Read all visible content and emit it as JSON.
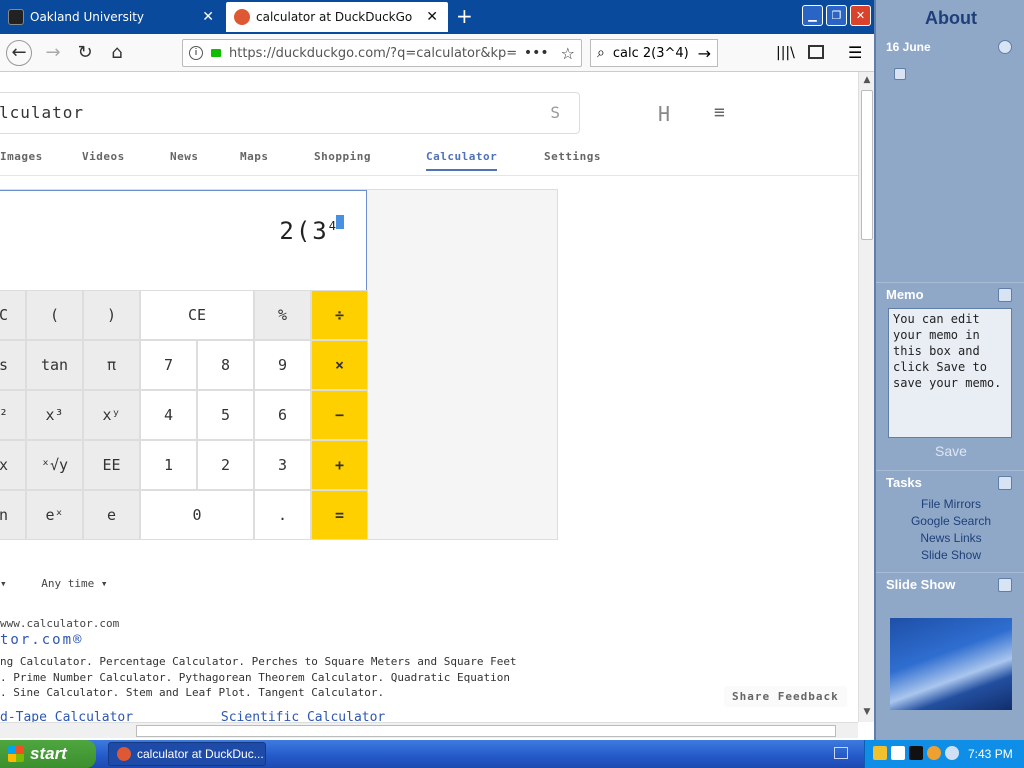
{
  "tabs": [
    {
      "title": "Oakland University",
      "close": "✕"
    },
    {
      "title": "calculator at DuckDuckGo",
      "close": "✕"
    }
  ],
  "new_tab_label": "+",
  "window_buttons": {
    "minimize": "▁",
    "maximize": "❐",
    "close": "✕"
  },
  "nav": {
    "back": "←",
    "forward": "→",
    "reload": "↻",
    "home": "⌂"
  },
  "url": {
    "info": "i",
    "text": "https://duckduckgo.com/?q=calculator&kp=",
    "more": "•••",
    "star": "☆"
  },
  "search": {
    "icon": "⌕",
    "value": "calc 2(3^4)",
    "go": "→"
  },
  "toolbar": {
    "library": "|||\\",
    "menu": "☰"
  },
  "page": {
    "query": "lculator",
    "query_suffix": "S",
    "logo_fragment": "H",
    "menu_glyph": "≡",
    "nav_tabs": [
      "Images",
      "Videos",
      "News",
      "Maps",
      "Shopping",
      "Calculator",
      "Settings"
    ],
    "active_tab": "Calculator"
  },
  "calculator": {
    "expression": "2(3",
    "exponent": "4",
    "keys": [
      [
        "C",
        "(",
        ")",
        "CE",
        "",
        "%",
        "÷"
      ],
      [
        "s",
        "tan",
        "π",
        "7",
        "8",
        "9",
        "×"
      ],
      [
        "²",
        "x³",
        "xʸ",
        "4",
        "5",
        "6",
        "−"
      ],
      [
        "x",
        "ˣ√y",
        "EE",
        "1",
        "2",
        "3",
        "+"
      ],
      [
        "n",
        "eˣ",
        "e",
        "0",
        "",
        ".",
        "="
      ]
    ]
  },
  "results": {
    "filter1": "▾",
    "filter2": "Any time ▾",
    "url": "www.calculator.com",
    "title": "tor.com®",
    "desc1": "ng Calculator. Percentage Calculator. Perches to Square Meters and Square Feet",
    "desc2": ". Prime Number Calculator. Pythagorean Theorem Calculator. Quadratic Equation",
    "desc3": ". Sine Calculator. Stem and Leaf Plot. Tangent Calculator.",
    "link1": "d-Tape Calculator",
    "link2": "Scientific Calculator",
    "feedback": "Share Feedback"
  },
  "sidebar": {
    "title": "About",
    "date": "16 June",
    "memo_heading": "Memo",
    "memo_text": "You can edit your memo in this box and click Save to save your memo.",
    "save_label": "Save",
    "tasks_heading": "Tasks",
    "tasks": [
      "File Mirrors",
      "Google Search",
      "News Links",
      "Slide Show"
    ],
    "slideshow_heading": "Slide Show"
  },
  "taskbar": {
    "start_label": "start",
    "window_item": "calculator at DuckDuc...",
    "clock": "7:43 PM"
  },
  "colors": {
    "calc_operator": "#ffd000",
    "active_tab": "#4f72b8",
    "taskbar": "#2458c8",
    "sidebar": "#8fa8c8"
  }
}
